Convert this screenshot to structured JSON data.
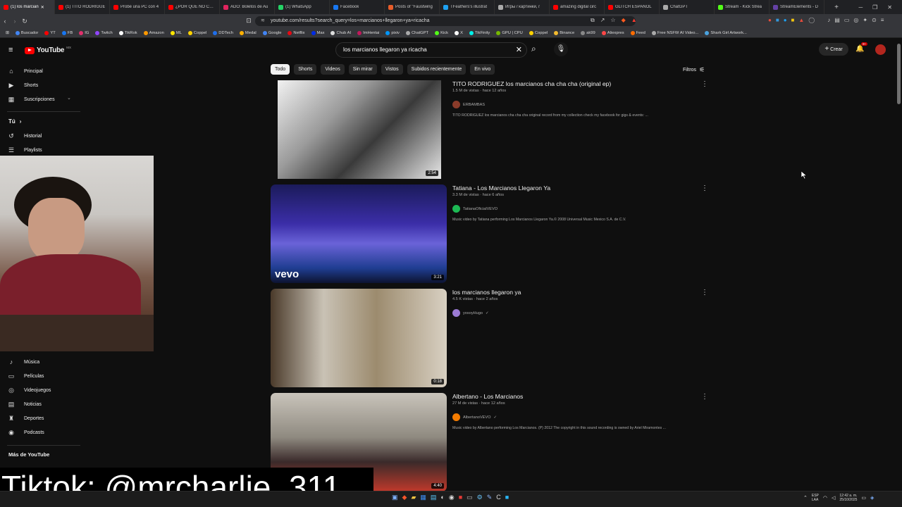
{
  "browser": {
    "tabs": [
      {
        "title": "(1) los marcian",
        "color": "#ff0000",
        "active": true
      },
      {
        "title": "(1) TITO RODRIGUE",
        "color": "#ff0000"
      },
      {
        "title": "Probé una PC con 4",
        "color": "#ff0000"
      },
      {
        "title": "¿POR QUÉ NO COM",
        "color": "#ff0000"
      },
      {
        "title": "ADO: Boletos de Au",
        "color": "#e0245e"
      },
      {
        "title": "(1) WhatsApp",
        "color": "#25d366"
      },
      {
        "title": "Facebook",
        "color": "#1877f2"
      },
      {
        "title": "Posts of \"Faustwing",
        "color": "#e85d2a"
      },
      {
        "title": "TFeathers's illustrat",
        "color": "#1da1f2"
      },
      {
        "title": "Игры / картинки, г",
        "color": "#aaaaaa"
      },
      {
        "title": "amazing digital circ",
        "color": "#ff0000"
      },
      {
        "title": "GLITCH ESPAÑOL",
        "color": "#ff0000"
      },
      {
        "title": "ChatGPT",
        "color": "#aaaaaa"
      },
      {
        "title": "Stream - Kick Strea",
        "color": "#53fc18"
      },
      {
        "title": "StreamElements - D",
        "color": "#6441a5"
      }
    ],
    "url": "youtube.com/results?search_query=los+marcianos+llegaron+ya+ricacha",
    "bookmarks": [
      {
        "label": "Buscador",
        "color": "#4285f4"
      },
      {
        "label": "YT",
        "color": "#ff0000"
      },
      {
        "label": "FB",
        "color": "#1877f2"
      },
      {
        "label": "IG",
        "color": "#e1306c"
      },
      {
        "label": "Twitch",
        "color": "#9146ff"
      },
      {
        "label": "TikRok",
        "color": "#ffffff"
      },
      {
        "label": "Amazon",
        "color": "#ff9900"
      },
      {
        "label": "ML",
        "color": "#ffe600"
      },
      {
        "label": "Coppel",
        "color": "#ffd200"
      },
      {
        "label": "DDTech",
        "color": "#1f6feb"
      },
      {
        "label": "Medal",
        "color": "#ffb000"
      },
      {
        "label": "Google",
        "color": "#4285f4"
      },
      {
        "label": "Netflix",
        "color": "#e50914"
      },
      {
        "label": "Max",
        "color": "#002be7"
      },
      {
        "label": "Chub AI",
        "color": "#dddddd"
      },
      {
        "label": "ImHentai",
        "color": "#c2185b"
      },
      {
        "label": "pixiv",
        "color": "#0096fa"
      },
      {
        "label": "ChatGPT",
        "color": "#aaaaaa"
      },
      {
        "label": "Kick",
        "color": "#53fc18"
      },
      {
        "label": "X",
        "color": "#ffffff"
      },
      {
        "label": "TikFinity",
        "color": "#00f2ea"
      },
      {
        "label": "GPU | CPU",
        "color": "#76b900"
      },
      {
        "label": "Coppel",
        "color": "#ffd200"
      },
      {
        "label": "Binance",
        "color": "#f3ba2f"
      },
      {
        "label": "ak99",
        "color": "#888888"
      },
      {
        "label": "Aliexpres",
        "color": "#ff4747"
      },
      {
        "label": "Feed",
        "color": "#ff6d00"
      },
      {
        "label": "Free NSFW AI Video...",
        "color": "#aaaaaa"
      },
      {
        "label": "Shark Girl Artwork...",
        "color": "#4aa3df"
      }
    ]
  },
  "youtube": {
    "logo": "YouTube",
    "region": "MX",
    "search_value": "los marcianos llegaron ya ricacha",
    "create_label": "Crear",
    "notification_count": "9+",
    "filters_label": "Filtros",
    "chips": [
      "Todo",
      "Shorts",
      "Videos",
      "Sin mirar",
      "Vistos",
      "Subidos recientemente",
      "En vivo"
    ],
    "sidebar_top": [
      {
        "label": "Principal",
        "icon": "home-icon"
      },
      {
        "label": "Shorts",
        "icon": "shorts-icon"
      },
      {
        "label": "Suscripciones",
        "icon": "subscriptions-icon"
      }
    ],
    "you_label": "Tú",
    "sidebar_you": [
      {
        "label": "Historial",
        "icon": "history-icon"
      },
      {
        "label": "Playlists",
        "icon": "playlists-icon"
      }
    ],
    "sidebar_explore": [
      {
        "label": "Música",
        "icon": "music-icon"
      },
      {
        "label": "Películas",
        "icon": "movies-icon"
      },
      {
        "label": "Videojuegos",
        "icon": "gaming-icon"
      },
      {
        "label": "Noticias",
        "icon": "news-icon"
      },
      {
        "label": "Deportes",
        "icon": "sports-icon"
      },
      {
        "label": "Podcasts",
        "icon": "podcasts-icon"
      }
    ],
    "more_label": "Más de YouTube",
    "results": [
      {
        "title": "TITO RODRIGUEZ los marcianos cha cha cha (original ep)",
        "meta": "1.5 M de vistas · hace 12 años",
        "channel": "ERBAMBAS",
        "desc": "TITO RODRIGUEZ los marcianos cha cha cha original record from my collection check my facebook for gigs & events: ...",
        "duration": "2:54",
        "thumb": "linear-gradient(135deg,#f2f2f2 0%,#9a9a9a 35%,#3a3a3a 60%,#e8e8e8 100%)",
        "avatar": "#8a3b2a"
      },
      {
        "title": "Tatiana - Los Marcianos Llegaron Ya",
        "meta": "3.3 M de vistas · hace 6 años",
        "channel": "TatianaOficialVEVO",
        "desc": "Music video by Tatiana performing Los Marcianos Llegaron Ya.© 2008 Universal Music Mexico S.A. de C.V.",
        "duration": "3:21",
        "thumb": "linear-gradient(180deg,#1b1b5a 0%,#3b2ea8 40%,#6a63d8 60%,#1f3d91 85%,#0d1330 100%)",
        "avatar": "#1db954",
        "watermark": "vevo"
      },
      {
        "title": "los marcianos llegaron ya",
        "meta": "4.5 K vistas · hace 2 años",
        "channel": "yosoyHugo",
        "desc": "",
        "duration": "0:18",
        "thumb": "linear-gradient(90deg,#4a3a2a 0%,#c9c2b5 30%,#9c8b6e 60%,#d8d0c2 100%)",
        "avatar": "#9b7bd4"
      },
      {
        "title": "Albertano - Los Marcianos",
        "meta": "27 M de vistas · hace 12 años",
        "channel": "AlbertanoVEVO",
        "desc": "Music video by Albertano performing Los Marcianos. (P) 2012 The copyright in this sound recording is owned by Ariel Miramontes ...",
        "duration": "4:40",
        "thumb": "linear-gradient(180deg,#c9c4bb 0%,#8f8a80 45%,#3a2a2a 70%,#c0392b 100%)",
        "avatar": "#f57c00"
      }
    ]
  },
  "overlay": {
    "tiktok": "Tiktok: @mrcharlie_311"
  },
  "taskbar": {
    "lang": "ESP",
    "lang_sub": "LAA",
    "time": "12:42 a. m.",
    "date": "25/10/2025"
  }
}
